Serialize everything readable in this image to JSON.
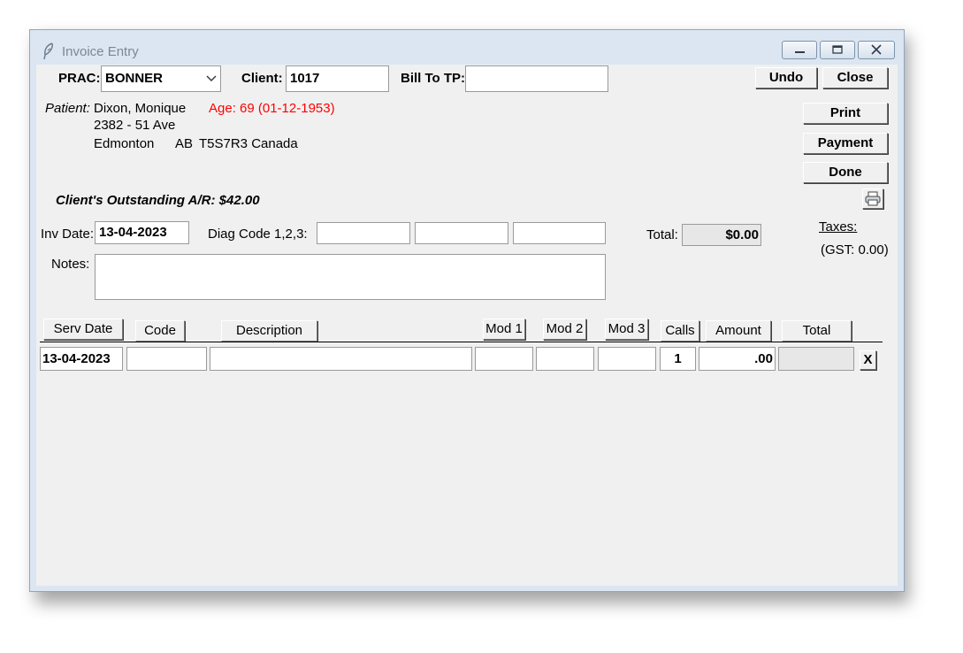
{
  "window": {
    "title": "Invoice Entry"
  },
  "header": {
    "prac_label": "PRAC:",
    "prac_value": "BONNER",
    "client_label": "Client:",
    "client_value": "1017",
    "billto_label": "Bill To TP:",
    "billto_value": ""
  },
  "buttons": {
    "undo": "Undo",
    "close": "Close",
    "print": "Print",
    "payment": "Payment",
    "done": "Done",
    "delete_row": "X"
  },
  "patient": {
    "label": "Patient:",
    "name": "Dixon, Monique",
    "age": "Age: 69 (01-12-1953)",
    "address1": "2382 - 51 Ave",
    "city": "Edmonton",
    "province": "AB",
    "postal_country": "T5S7R3 Canada"
  },
  "outstanding": "Client's Outstanding A/R: $42.00",
  "invoice": {
    "inv_date_label": "Inv Date:",
    "inv_date": "13-04-2023",
    "diag_label": "Diag Code 1,2,3:",
    "diag1": "",
    "diag2": "",
    "diag3": "",
    "total_label": "Total:",
    "total_value": "$0.00",
    "taxes_label": "Taxes:",
    "gst": "(GST: 0.00)",
    "notes_label": "Notes:",
    "notes_value": ""
  },
  "table": {
    "columns": [
      "Serv Date",
      "Code",
      "Description",
      "Mod 1",
      "Mod 2",
      "Mod 3",
      "Calls",
      "Amount",
      "Total"
    ],
    "rows": [
      {
        "serv_date": "13-04-2023",
        "code": "",
        "description": "",
        "mod1": "",
        "mod2": "",
        "mod3": "",
        "calls": "1",
        "amount": ".00",
        "total": ""
      }
    ]
  },
  "colors": {
    "age_text": "#ff0000",
    "window_frame": "#dbe6f2",
    "client_bg": "#f0f0f0"
  }
}
